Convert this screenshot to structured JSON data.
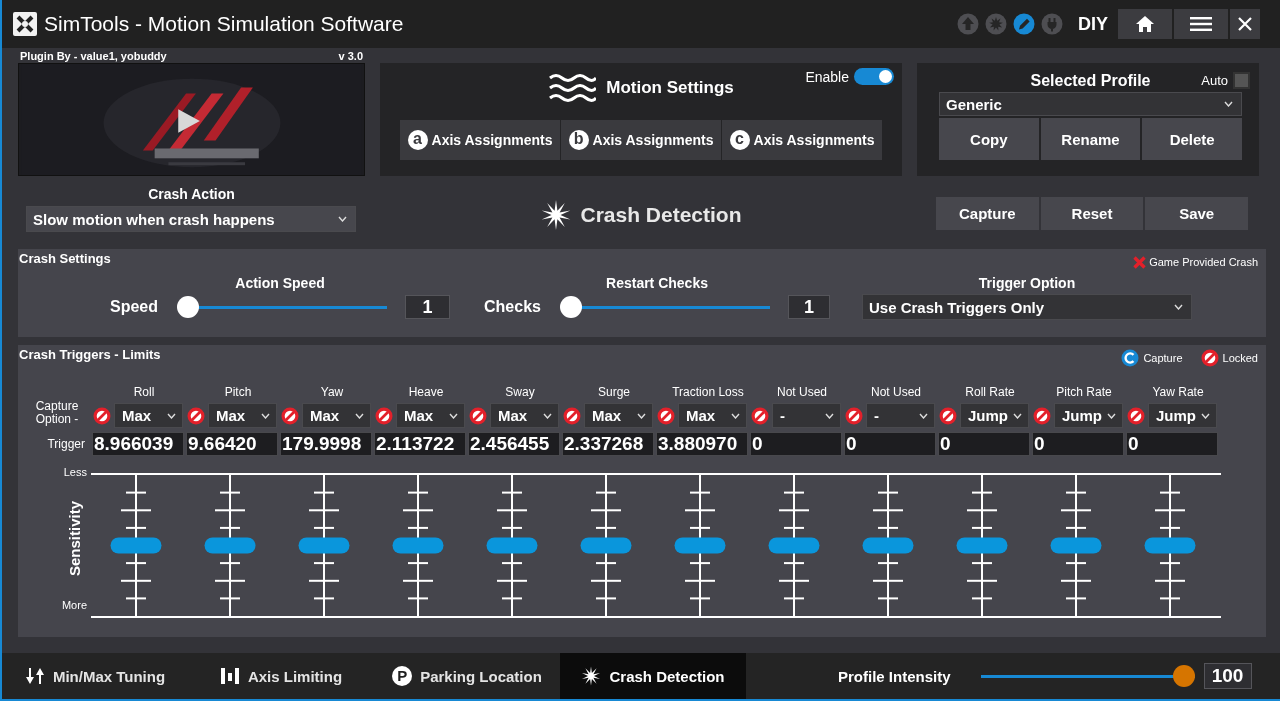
{
  "window": {
    "title": "SimTools - Motion Simulation Software"
  },
  "title_bar": {
    "status_icons": [
      {
        "kind": "upload",
        "selected": false
      },
      {
        "kind": "burst",
        "selected": false
      },
      {
        "kind": "pen",
        "selected": true
      },
      {
        "kind": "plug",
        "selected": false
      }
    ],
    "mode": "DIY"
  },
  "plugin": {
    "author": "Plugin By - value1, yobuddy",
    "version": "v 3.0"
  },
  "crash_action": {
    "label": "Crash Action",
    "value": "Slow motion when crash happens"
  },
  "motion_settings": {
    "title": "Motion Settings",
    "enable_label": "Enable",
    "enabled": true,
    "axis_buttons": [
      {
        "badge": "a",
        "label": "Axis Assignments"
      },
      {
        "badge": "b",
        "label": "Axis Assignments"
      },
      {
        "badge": "c",
        "label": "Axis Assignments"
      }
    ]
  },
  "profile": {
    "title": "Selected Profile",
    "auto_label": "Auto",
    "auto": false,
    "value": "Generic",
    "buttons": [
      "Copy",
      "Rename",
      "Delete"
    ]
  },
  "heading": "Crash Detection",
  "actions": [
    "Capture",
    "Reset",
    "Save"
  ],
  "crash_settings": {
    "title": "Crash Settings",
    "game_provided_crash": {
      "label": "Game Provided Crash",
      "available": false
    },
    "action_speed": {
      "title": "Action Speed",
      "label": "Speed",
      "level": 0,
      "reading": "1"
    },
    "restart_checks": {
      "title": "Restart Checks",
      "label": "Checks",
      "level": 0,
      "reading": "1"
    },
    "trigger_option": {
      "title": "Trigger Option",
      "value": "Use Crash Triggers Only"
    }
  },
  "crash_triggers": {
    "title": "Crash Triggers - Limits",
    "legend": [
      {
        "kind": "capture",
        "label": "Capture"
      },
      {
        "kind": "locked",
        "label": "Locked"
      }
    ],
    "option_label": "Capture Option -",
    "trigger_label": "Trigger",
    "less_label": "Less",
    "more_label": "More",
    "sensitivity_label": "Sensitivity",
    "axes": [
      {
        "name": "Roll",
        "locked": true,
        "option": "Max",
        "trigger": "8.966039",
        "level": 0.5
      },
      {
        "name": "Pitch",
        "locked": true,
        "option": "Max",
        "trigger": "9.66420",
        "level": 0.5
      },
      {
        "name": "Yaw",
        "locked": true,
        "option": "Max",
        "trigger": "179.9998",
        "level": 0.5
      },
      {
        "name": "Heave",
        "locked": true,
        "option": "Max",
        "trigger": "2.113722",
        "level": 0.5
      },
      {
        "name": "Sway",
        "locked": true,
        "option": "Max",
        "trigger": "2.456455",
        "level": 0.5
      },
      {
        "name": "Surge",
        "locked": true,
        "option": "Max",
        "trigger": "2.337268",
        "level": 0.5
      },
      {
        "name": "Traction Loss",
        "locked": true,
        "option": "Max",
        "trigger": "3.880970",
        "level": 0.5
      },
      {
        "name": "Not Used",
        "locked": true,
        "option": "-",
        "trigger": "0",
        "level": 0.5
      },
      {
        "name": "Not Used",
        "locked": true,
        "option": "-",
        "trigger": "0",
        "level": 0.5
      },
      {
        "name": "Roll Rate",
        "locked": true,
        "option": "Jump",
        "trigger": "0",
        "level": 0.5
      },
      {
        "name": "Pitch Rate",
        "locked": true,
        "option": "Jump",
        "trigger": "0",
        "level": 0.5
      },
      {
        "name": "Yaw Rate",
        "locked": true,
        "option": "Jump",
        "trigger": "0",
        "level": 0.5
      }
    ]
  },
  "bottom_tabs": [
    {
      "kind": "minmax",
      "label": "Min/Max Tuning",
      "selected": false
    },
    {
      "kind": "limiting",
      "label": "Axis Limiting",
      "selected": false
    },
    {
      "kind": "parking",
      "badge": "P",
      "label": "Parking Location",
      "selected": false
    },
    {
      "kind": "crash",
      "label": "Crash Detection",
      "selected": true
    }
  ],
  "profile_intensity": {
    "label": "Profile Intensity",
    "level": 1,
    "reading": "100"
  }
}
